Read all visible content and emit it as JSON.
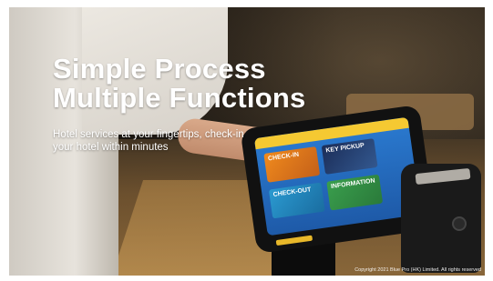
{
  "slide": {
    "headline_line1": "Simple Process",
    "headline_line2": "Multiple Functions",
    "subtitle_line1": "Hotel services at your fingertips, check-in",
    "subtitle_line2": "your hotel within minutes",
    "copyright": "Copyright 2021 Blue Pro (HK) Limited. All rights reserved"
  },
  "kiosk_screen": {
    "tiles": [
      "CHECK-IN",
      "KEY PICKUP",
      "CHECK-OUT",
      "INFORMATION"
    ]
  },
  "colors": {
    "headline": "#ffffff",
    "screen_accent": "#f5c932",
    "screen_primary": "#2b7bd1"
  }
}
